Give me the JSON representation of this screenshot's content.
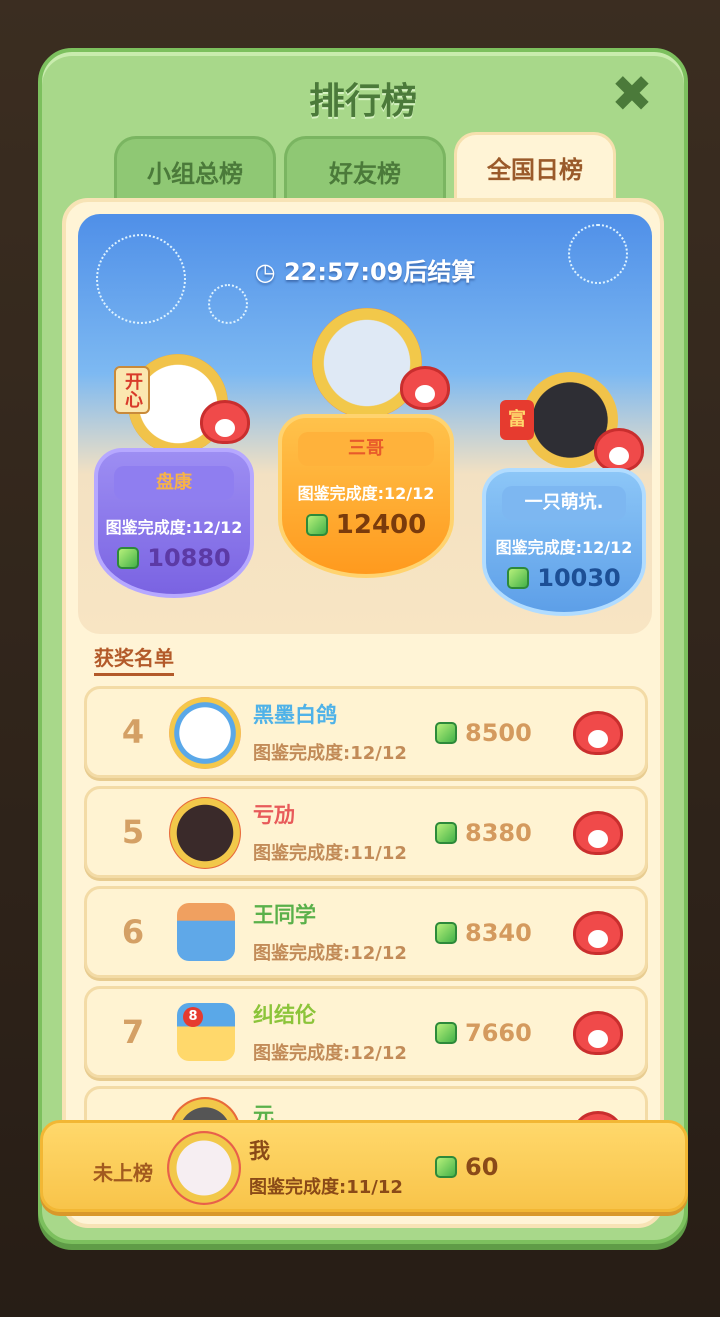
{
  "title": "排行榜",
  "close_icon": "close-icon",
  "tabs": [
    {
      "label": "小组总榜",
      "active": false
    },
    {
      "label": "好友榜",
      "active": false
    },
    {
      "label": "全国日榜",
      "active": true
    }
  ],
  "timer": "22:57:09后结算",
  "podium": {
    "first": {
      "badge_text": "",
      "name": "三哥",
      "completion": "图鉴完成度:12/12",
      "score": "12400"
    },
    "second": {
      "badge_text": "开心",
      "name": "盘康",
      "completion": "图鉴完成度:12/12",
      "score": "10880"
    },
    "third": {
      "badge_text": "富",
      "name": "一只萌坑.",
      "completion": "图鉴完成度:12/12",
      "score": "10030"
    }
  },
  "awards_label": "获奖名单",
  "rows": [
    {
      "rank": "4",
      "name": "黑墨白鸽",
      "completion": "图鉴完成度:12/12",
      "score": "8500"
    },
    {
      "rank": "5",
      "name": "亏劢",
      "completion": "图鉴完成度:11/12",
      "score": "8380"
    },
    {
      "rank": "6",
      "name": "王同学",
      "completion": "图鉴完成度:12/12",
      "score": "8340"
    },
    {
      "rank": "7",
      "name": "纠结伦",
      "completion": "图鉴完成度:12/12",
      "score": "7660"
    },
    {
      "rank": "",
      "name": "元",
      "completion": "",
      "score": ""
    }
  ],
  "me": {
    "status": "未上榜",
    "name": "我",
    "completion": "图鉴完成度:11/12",
    "score": "60"
  },
  "row7_badge": "8",
  "colors": {
    "green": "#a8d88a",
    "cream": "#fff4d6",
    "gold": "#f8c44a"
  }
}
